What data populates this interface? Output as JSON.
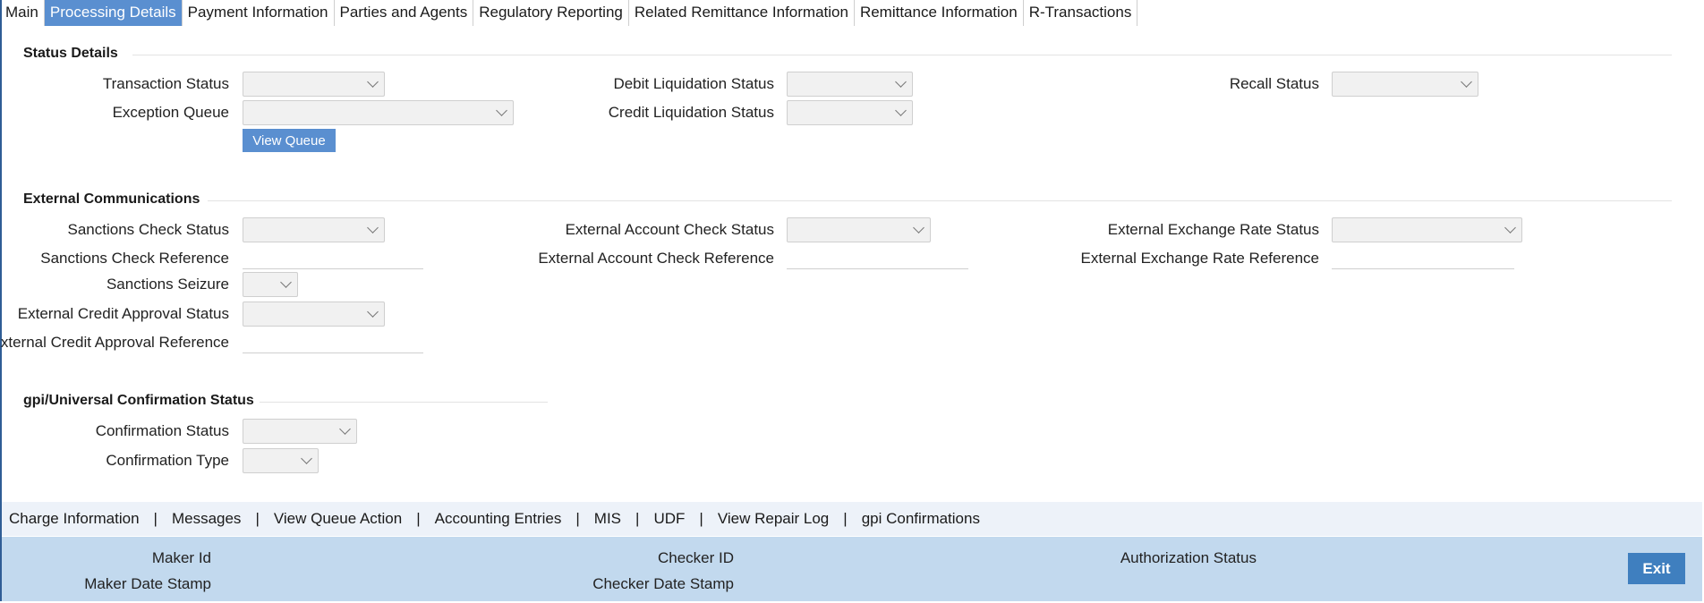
{
  "tabs": [
    {
      "label": "Main"
    },
    {
      "label": "Processing Details"
    },
    {
      "label": "Payment Information"
    },
    {
      "label": "Parties and Agents"
    },
    {
      "label": "Regulatory Reporting"
    },
    {
      "label": "Related Remittance Information"
    },
    {
      "label": "Remittance Information"
    },
    {
      "label": "R-Transactions"
    }
  ],
  "status_details": {
    "title": "Status Details",
    "transaction_status": "Transaction Status",
    "exception_queue": "Exception Queue",
    "view_queue_button": "View Queue",
    "debit_liquidation_status": "Debit Liquidation Status",
    "credit_liquidation_status": "Credit Liquidation Status",
    "recall_status": "Recall Status"
  },
  "external_comm": {
    "title": "External Communications",
    "sanctions_check_status": "Sanctions Check Status",
    "sanctions_check_reference": "Sanctions Check Reference",
    "sanctions_seizure": "Sanctions Seizure",
    "ext_credit_approval_status": "External Credit Approval Status",
    "ext_credit_approval_reference": "External Credit Approval Reference",
    "ext_account_check_status": "External Account Check Status",
    "ext_account_check_reference": "External Account Check Reference",
    "ext_exchange_rate_status": "External Exchange Rate Status",
    "ext_exchange_rate_reference": "External Exchange Rate Reference"
  },
  "gpi": {
    "title": "gpi/Universal Confirmation Status",
    "confirmation_status": "Confirmation Status",
    "confirmation_type": "Confirmation Type"
  },
  "links": [
    {
      "label": "Charge Information"
    },
    {
      "label": "Messages"
    },
    {
      "label": "View Queue Action"
    },
    {
      "label": "Accounting Entries"
    },
    {
      "label": "MIS"
    },
    {
      "label": "UDF"
    },
    {
      "label": "View Repair Log"
    },
    {
      "label": "gpi Confirmations"
    }
  ],
  "link_separator": "|",
  "footer": {
    "maker_id": "Maker Id",
    "maker_date_stamp": "Maker Date Stamp",
    "checker_id": "Checker ID",
    "checker_date_stamp": "Checker Date Stamp",
    "authorization_status": "Authorization Status",
    "exit_button": "Exit"
  },
  "colors": {
    "active_tab": "#5a8fd0",
    "link_bar": "#edf2f9",
    "footer": "#c2d9ee",
    "exit_button": "#3f7fbf"
  }
}
